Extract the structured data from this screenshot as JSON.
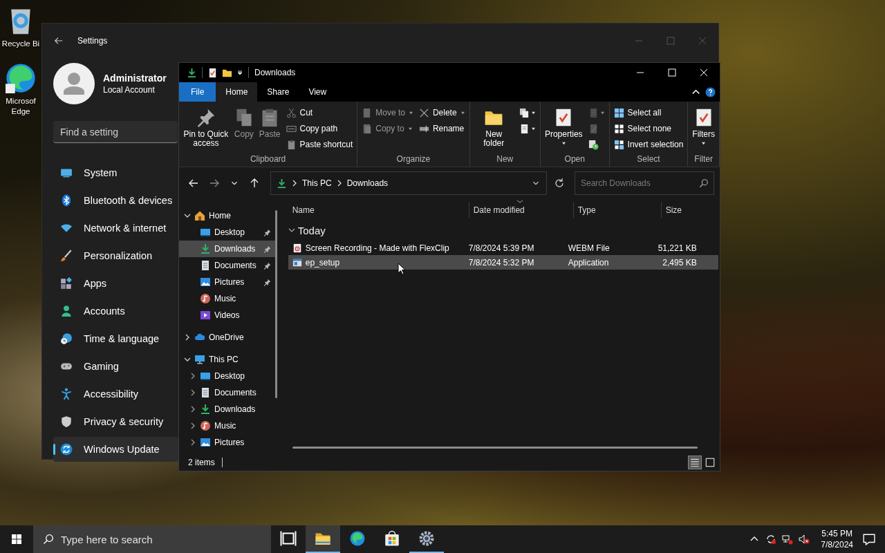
{
  "desktop": {
    "icons": [
      {
        "kind": "recycle",
        "label": "Recycle Bi"
      },
      {
        "kind": "edge",
        "label": "Microsof Edge"
      }
    ]
  },
  "settings": {
    "title": "Settings",
    "user": {
      "name": "Administrator",
      "account": "Local Account"
    },
    "search": {
      "placeholder": "Find a setting"
    },
    "nav": [
      {
        "kind": "system",
        "label": "System",
        "selected": false
      },
      {
        "kind": "bluetooth",
        "label": "Bluetooth & devices",
        "selected": false
      },
      {
        "kind": "network",
        "label": "Network & internet",
        "selected": false
      },
      {
        "kind": "personalization",
        "label": "Personalization",
        "selected": false
      },
      {
        "kind": "apps",
        "label": "Apps",
        "selected": false
      },
      {
        "kind": "accounts",
        "label": "Accounts",
        "selected": false
      },
      {
        "kind": "time",
        "label": "Time & language",
        "selected": false
      },
      {
        "kind": "gaming",
        "label": "Gaming",
        "selected": false
      },
      {
        "kind": "accessibility",
        "label": "Accessibility",
        "selected": false
      },
      {
        "kind": "privacy",
        "label": "Privacy & security",
        "selected": false
      },
      {
        "kind": "update",
        "label": "Windows Update",
        "selected": true
      }
    ]
  },
  "explorer": {
    "title": "Downloads",
    "tabs": [
      {
        "kind": "file",
        "label": "File",
        "selected": false
      },
      {
        "kind": "tab",
        "label": "Home",
        "selected": true
      },
      {
        "kind": "tab",
        "label": "Share",
        "selected": false
      },
      {
        "kind": "tab",
        "label": "View",
        "selected": false
      }
    ],
    "ribbon": [
      {
        "label": "Clipboard",
        "columns": [
          [
            {
              "kind": "large",
              "label": "Pin to Quick access",
              "disabled": false,
              "menu": false
            }
          ],
          [
            {
              "kind": "large",
              "label": "Copy",
              "disabled": true,
              "menu": false
            }
          ],
          [
            {
              "kind": "large",
              "label": "Paste",
              "disabled": true,
              "menu": false
            }
          ],
          [
            {
              "kind": "small",
              "label": "Cut",
              "disabled": false,
              "menu": false
            },
            {
              "kind": "small",
              "label": "Copy path",
              "disabled": false,
              "menu": false
            },
            {
              "kind": "small",
              "label": "Paste shortcut",
              "disabled": false,
              "menu": false
            }
          ]
        ]
      },
      {
        "label": "Organize",
        "columns": [
          [
            {
              "kind": "small",
              "label": "Move to",
              "disabled": true,
              "menu": true
            },
            {
              "kind": "small",
              "label": "Copy to",
              "disabled": true,
              "menu": true
            }
          ],
          [
            {
              "kind": "small",
              "label": "Delete",
              "disabled": false,
              "menu": true
            },
            {
              "kind": "small",
              "label": "Rename",
              "disabled": false,
              "menu": false
            }
          ]
        ]
      },
      {
        "label": "New",
        "columns": [
          [
            {
              "kind": "large",
              "label": "New folder",
              "disabled": false,
              "menu": false
            }
          ],
          [
            {
              "kind": "icon",
              "disabled": false,
              "menu": true
            },
            {
              "kind": "icon",
              "disabled": false,
              "menu": true
            }
          ]
        ]
      },
      {
        "label": "Open",
        "columns": [
          [
            {
              "kind": "large",
              "label": "Properties",
              "disabled": false,
              "menu": true
            }
          ],
          [
            {
              "kind": "icon",
              "disabled": true,
              "menu": true
            },
            {
              "kind": "icon",
              "disabled": true,
              "menu": false
            },
            {
              "kind": "icon",
              "disabled": false,
              "menu": false
            }
          ]
        ]
      },
      {
        "label": "Select",
        "columns": [
          [
            {
              "kind": "small",
              "label": "Select all",
              "disabled": false,
              "menu": false
            },
            {
              "kind": "small",
              "label": "Select none",
              "disabled": false,
              "menu": false
            },
            {
              "kind": "small",
              "label": "Invert selection",
              "disabled": false,
              "menu": false
            }
          ]
        ]
      },
      {
        "label": "Filter",
        "columns": [
          [
            {
              "kind": "large",
              "label": "Filters",
              "disabled": false,
              "menu": true
            }
          ]
        ]
      }
    ],
    "address": {
      "path": [
        "This PC",
        "Downloads"
      ]
    },
    "search": {
      "placeholder": "Search Downloads"
    },
    "nav_pane": [
      {
        "kind": "home",
        "label": "Home",
        "expanded": true,
        "selected": false,
        "children": [
          {
            "kind": "desktop",
            "label": "Desktop",
            "pinned": true,
            "selected": false
          },
          {
            "kind": "downloads",
            "label": "Downloads",
            "pinned": true,
            "selected": true
          },
          {
            "kind": "documents",
            "label": "Documents",
            "pinned": true,
            "selected": false
          },
          {
            "kind": "pictures",
            "label": "Pictures",
            "pinned": true,
            "selected": false
          },
          {
            "kind": "music",
            "label": "Music",
            "pinned": false,
            "selected": false
          },
          {
            "kind": "videos",
            "label": "Videos",
            "pinned": false,
            "selected": false
          }
        ]
      },
      {
        "kind": "onedrive",
        "label": "OneDrive",
        "expanded": false,
        "selected": false
      },
      {
        "kind": "pc",
        "label": "This PC",
        "expanded": true,
        "selected": false,
        "children": [
          {
            "kind": "desktop",
            "label": "Desktop",
            "expanded": false,
            "selected": false
          },
          {
            "kind": "documents",
            "label": "Documents",
            "expanded": false,
            "selected": false
          },
          {
            "kind": "downloads",
            "label": "Downloads",
            "expanded": false,
            "selected": false
          },
          {
            "kind": "music",
            "label": "Music",
            "expanded": false,
            "selected": false
          },
          {
            "kind": "pictures",
            "label": "Pictures",
            "expanded": false,
            "selected": false
          }
        ]
      }
    ],
    "columns": [
      {
        "label": "Name",
        "sorted": false
      },
      {
        "label": "Date modified",
        "sorted": true
      },
      {
        "label": "Type",
        "sorted": false
      },
      {
        "label": "Size",
        "sorted": false
      }
    ],
    "groups": [
      {
        "label": "Today",
        "expanded": true,
        "files": [
          {
            "kind": "video",
            "name": "Screen Recording - Made with FlexClip",
            "date": "7/8/2024 5:39 PM",
            "type": "WEBM File",
            "size": "51,221 KB",
            "selected": false
          },
          {
            "kind": "application",
            "name": "ep_setup",
            "date": "7/8/2024 5:32 PM",
            "type": "Application",
            "size": "2,495 KB",
            "selected": true
          }
        ]
      }
    ],
    "status": {
      "count": "2 items"
    },
    "views": [
      {
        "kind": "details",
        "selected": true
      },
      {
        "kind": "tiles",
        "selected": false
      }
    ]
  },
  "taskbar": {
    "search": {
      "placeholder": "Type here to search"
    },
    "apps": [
      {
        "kind": "taskview",
        "active": false,
        "running": false
      },
      {
        "kind": "explorer",
        "active": true,
        "running": true
      },
      {
        "kind": "edge",
        "active": false,
        "running": false
      },
      {
        "kind": "store",
        "active": false,
        "running": false
      },
      {
        "kind": "settings",
        "active": false,
        "running": true
      }
    ],
    "clock": {
      "time": "5:45 PM",
      "date": "7/8/2024"
    }
  }
}
